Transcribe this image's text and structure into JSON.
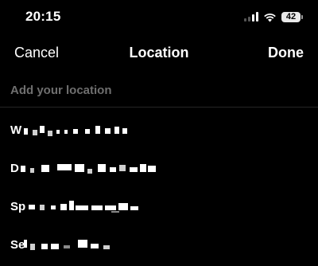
{
  "status_bar": {
    "time": "20:15",
    "battery": "42",
    "icons": [
      "cellular-signal-icon",
      "wifi-icon",
      "battery-icon"
    ]
  },
  "nav": {
    "cancel_label": "Cancel",
    "title": "Location",
    "done_label": "Done"
  },
  "search": {
    "placeholder": "Add your location",
    "value": ""
  },
  "locations": [
    {
      "label": "W"
    },
    {
      "label": "D"
    },
    {
      "label": "Sp"
    },
    {
      "label": "Se"
    }
  ],
  "colors": {
    "background": "#000000",
    "text": "#ffffff",
    "placeholder": "#6f6f6f",
    "divider": "#262626"
  }
}
